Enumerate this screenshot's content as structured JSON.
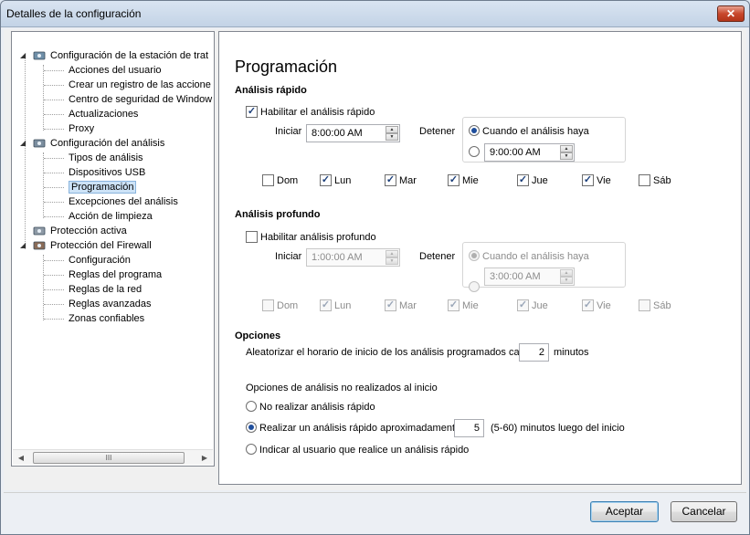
{
  "window": {
    "title": "Detalles de la configuración",
    "close_glyph": "✕"
  },
  "tree": {
    "items": [
      {
        "label": "Configuración de la estación de trat",
        "icon": "workstation-icon"
      },
      {
        "label": "Acciones del usuario"
      },
      {
        "label": "Crear un registro de las accione"
      },
      {
        "label": "Centro de seguridad de Window"
      },
      {
        "label": "Actualizaciones"
      },
      {
        "label": "Proxy"
      },
      {
        "label": "Configuración del análisis",
        "icon": "scan-icon"
      },
      {
        "label": "Tipos de análisis"
      },
      {
        "label": "Dispositivos USB"
      },
      {
        "label": "Programación",
        "selected": true
      },
      {
        "label": "Excepciones del análisis"
      },
      {
        "label": "Acción de limpieza"
      },
      {
        "label": "Protección activa",
        "icon": "active-protection-icon"
      },
      {
        "label": "Protección del Firewall",
        "icon": "firewall-icon"
      },
      {
        "label": "Configuración"
      },
      {
        "label": "Reglas del  programa"
      },
      {
        "label": "Reglas de la red"
      },
      {
        "label": "Reglas avanzadas"
      },
      {
        "label": "Zonas confiables"
      }
    ],
    "scroll_thumb_glyph": "III"
  },
  "main": {
    "title": "Programación",
    "quick": {
      "heading": "Análisis rápido",
      "enable_label": "Habilitar el análisis rápido",
      "enabled": true,
      "start_label": "Iniciar",
      "start_time": "8:00:00 AM",
      "stop_label": "Detener",
      "stop_when_label": "Cuando el análisis haya",
      "stop_time": "9:00:00 AM",
      "days": [
        {
          "label": "Dom",
          "checked": false
        },
        {
          "label": "Lun",
          "checked": true
        },
        {
          "label": "Mar",
          "checked": true
        },
        {
          "label": "Mie",
          "checked": true
        },
        {
          "label": "Jue",
          "checked": true
        },
        {
          "label": "Vie",
          "checked": true
        },
        {
          "label": "Sáb",
          "checked": false
        }
      ]
    },
    "deep": {
      "heading": "Análisis profundo",
      "enable_label": "Habilitar análisis profundo",
      "enabled": false,
      "start_label": "Iniciar",
      "start_time": "1:00:00 AM",
      "stop_label": "Detener",
      "stop_when_label": "Cuando el análisis haya",
      "stop_time": "3:00:00 AM",
      "days": [
        {
          "label": "Dom",
          "checked": false
        },
        {
          "label": "Lun",
          "checked": true
        },
        {
          "label": "Mar",
          "checked": true
        },
        {
          "label": "Mie",
          "checked": true
        },
        {
          "label": "Jue",
          "checked": true
        },
        {
          "label": "Vie",
          "checked": true
        },
        {
          "label": "Sáb",
          "checked": false
        }
      ]
    },
    "options": {
      "heading": "Opciones",
      "randomize_label": "Aleatorizar el horario de inicio de los análisis programados cada",
      "randomize_value": "2",
      "randomize_unit": "minutos",
      "missed_label": "Opciones de análisis no realizados al inicio",
      "missed_opt_none": "No realizar análisis rápido",
      "missed_opt_run": "Realizar un análisis rápido aproximadamente",
      "missed_run_value": "5",
      "missed_run_suffix": "(5-60) minutos luego del inicio",
      "missed_opt_ask": "Indicar al usuario que realice un análisis rápido",
      "selected_missed": "run"
    }
  },
  "buttons": {
    "accept": "Aceptar",
    "cancel": "Cancelar"
  }
}
